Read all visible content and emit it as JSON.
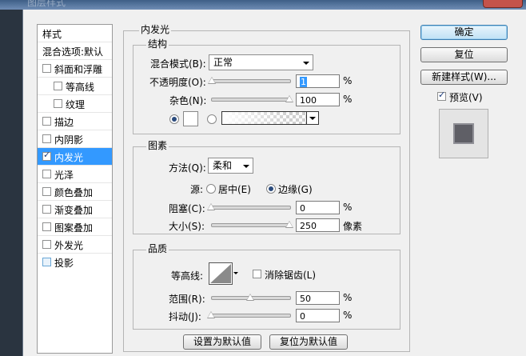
{
  "window": {
    "title": "图层样式"
  },
  "sidebar": {
    "header": "样式",
    "blending_options": "混合选项:默认",
    "items": [
      {
        "label": "斜面和浮雕",
        "checked": false
      },
      {
        "label": "等高线",
        "checked": false
      },
      {
        "label": "纹理",
        "checked": false
      },
      {
        "label": "描边",
        "checked": false
      },
      {
        "label": "内阴影",
        "checked": false
      },
      {
        "label": "内发光",
        "checked": true,
        "selected": true
      },
      {
        "label": "光泽",
        "checked": false
      },
      {
        "label": "颜色叠加",
        "checked": false
      },
      {
        "label": "渐变叠加",
        "checked": false
      },
      {
        "label": "图案叠加",
        "checked": false
      },
      {
        "label": "外发光",
        "checked": false
      },
      {
        "label": "投影",
        "checked": false
      }
    ]
  },
  "panel": {
    "title": "内发光",
    "structure": {
      "title": "结构",
      "blend_mode_label": "混合模式(B):",
      "blend_mode_value": "正常",
      "opacity_label": "不透明度(O):",
      "opacity_value": "1",
      "opacity_level": 0.01,
      "noise_label": "杂色(N):",
      "noise_value": "100",
      "noise_level": 1.0,
      "percent": "%"
    },
    "elements": {
      "title": "图素",
      "method_label": "方法(Q):",
      "method_value": "柔和",
      "source_label": "源:",
      "source_center": "居中(E)",
      "source_edge": "边缘(G)",
      "choke_label": "阻塞(C):",
      "choke_value": "0",
      "choke_level": 0.0,
      "size_label": "大小(S):",
      "size_value": "250",
      "size_level": 1.0,
      "size_unit": "像素",
      "percent": "%"
    },
    "quality": {
      "title": "品质",
      "contour_label": "等高线:",
      "anti_alias_label": "消除锯齿(L)",
      "range_label": "范围(R):",
      "range_value": "50",
      "range_level": 0.5,
      "jitter_label": "抖动(J):",
      "jitter_value": "0",
      "jitter_level": 0.0,
      "percent": "%"
    },
    "buttons": {
      "set_default": "设置为默认值",
      "reset_default": "复位为默认值"
    }
  },
  "right": {
    "ok": "确定",
    "reset": "复位",
    "new_style": "新建样式(W)...",
    "preview_label": "预览(V)",
    "preview_checked": true
  }
}
